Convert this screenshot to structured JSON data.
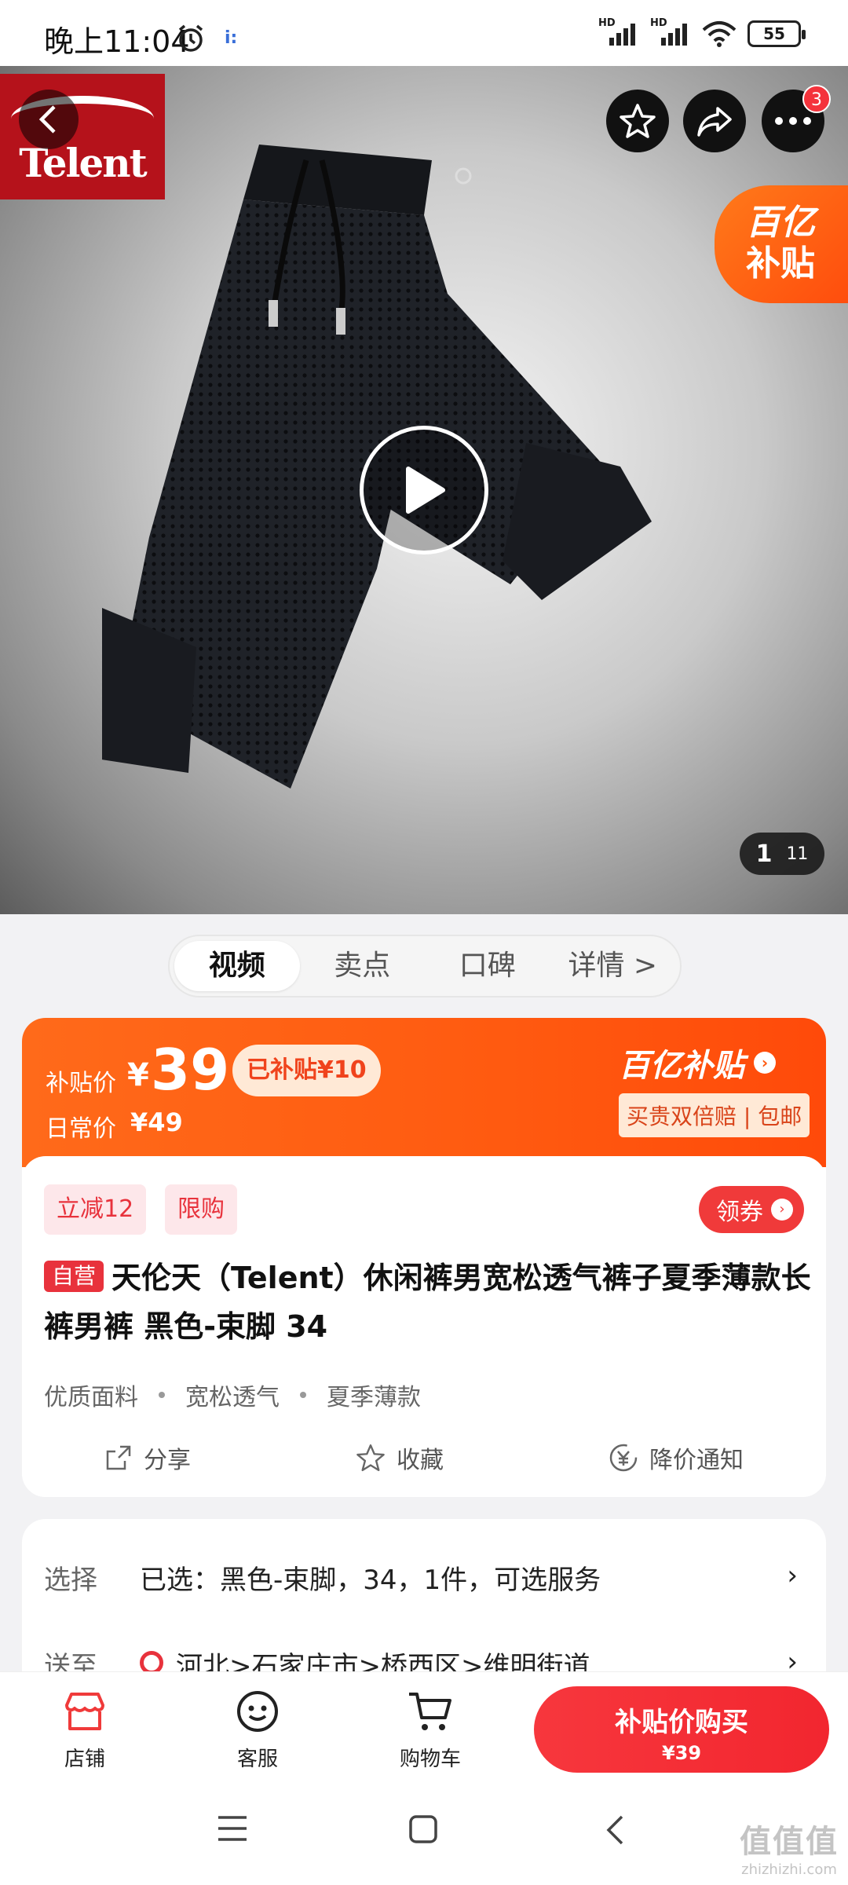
{
  "status_bar": {
    "time": "晚上11:04",
    "notif": "i:",
    "hd1": "HD",
    "hd2": "HD",
    "battery": "55"
  },
  "hero": {
    "brand_logo_text": "Telent",
    "more_badge": "3",
    "subsidy_tag_line1": "百亿",
    "subsidy_tag_line2": "补贴",
    "image_index": "1",
    "image_total": "11"
  },
  "media_tabs": [
    {
      "label": "视频",
      "active": true
    },
    {
      "label": "卖点",
      "active": false
    },
    {
      "label": "口碑",
      "active": false
    },
    {
      "label": "详情 >",
      "active": false
    }
  ],
  "price": {
    "subsidy_label": "补贴价",
    "currency": "¥",
    "value": "39",
    "subsidized_badge": "已补贴¥10",
    "daily_label": "日常价",
    "daily_value": "¥49",
    "program_name": "百亿补贴",
    "program_chevron": "›",
    "promise": "买贵双倍赔 | 包邮"
  },
  "tags": {
    "discount": "立减12",
    "limited": "限购"
  },
  "coupon": {
    "label": "领券",
    "chevron": "›"
  },
  "product": {
    "self_operated": "自营",
    "title": "天伦天（Telent）休闲裤男宽松透气裤子夏季薄款长裤男裤 黑色-束脚 34",
    "features": [
      "优质面料",
      "宽松透气",
      "夏季薄款"
    ]
  },
  "actions": {
    "share": "分享",
    "favorite": "收藏",
    "price_alert": "降价通知"
  },
  "selection": {
    "select_label": "选择",
    "select_value": "已选：黑色-束脚，34，1件，可选服务",
    "ship_label": "送至",
    "ship_value": "河北>石家庄市>桥西区>维明街道",
    "arrow": "›"
  },
  "bottom_bar": {
    "store": "店铺",
    "service": "客服",
    "cart": "购物车",
    "buy_label": "补贴价购买",
    "buy_price": "¥39"
  },
  "watermark": {
    "line1": "值值值",
    "line2": "zhizhizhi.com"
  }
}
